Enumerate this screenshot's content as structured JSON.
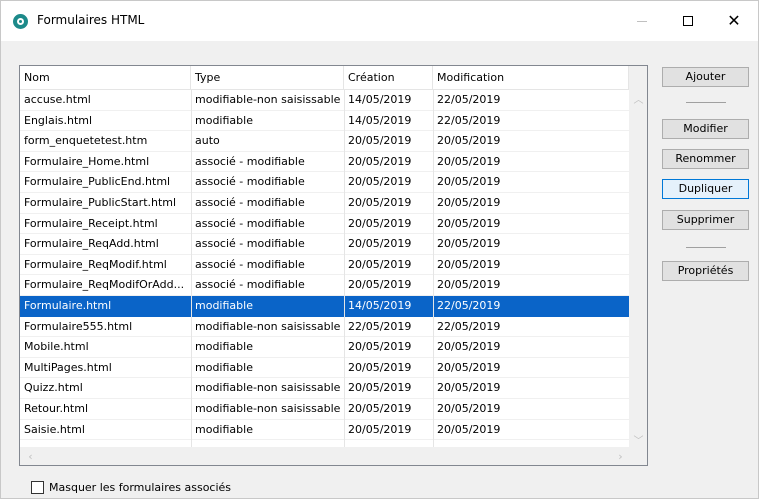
{
  "window": {
    "title": "Formulaires HTML",
    "icon": "app-logo-icon"
  },
  "list": {
    "columns": [
      "Nom",
      "Type",
      "Création",
      "Modification"
    ],
    "rows": [
      {
        "name": "accuse.html",
        "type": "modifiable-non saisissable",
        "created": "14/05/2019",
        "modified": "22/05/2019"
      },
      {
        "name": "Englais.html",
        "type": "modifiable",
        "created": "14/05/2019",
        "modified": "22/05/2019"
      },
      {
        "name": "form_enquetetest.htm",
        "type": "auto",
        "created": "20/05/2019",
        "modified": "20/05/2019"
      },
      {
        "name": "Formulaire_Home.html",
        "type": "associé - modifiable",
        "created": "20/05/2019",
        "modified": "20/05/2019"
      },
      {
        "name": "Formulaire_PublicEnd.html",
        "type": "associé - modifiable",
        "created": "20/05/2019",
        "modified": "20/05/2019"
      },
      {
        "name": "Formulaire_PublicStart.html",
        "type": "associé - modifiable",
        "created": "20/05/2019",
        "modified": "20/05/2019"
      },
      {
        "name": "Formulaire_Receipt.html",
        "type": "associé - modifiable",
        "created": "20/05/2019",
        "modified": "20/05/2019"
      },
      {
        "name": "Formulaire_ReqAdd.html",
        "type": "associé - modifiable",
        "created": "20/05/2019",
        "modified": "20/05/2019"
      },
      {
        "name": "Formulaire_ReqModif.html",
        "type": "associé - modifiable",
        "created": "20/05/2019",
        "modified": "20/05/2019"
      },
      {
        "name": "Formulaire_ReqModifOrAdd...",
        "type": "associé - modifiable",
        "created": "20/05/2019",
        "modified": "20/05/2019"
      },
      {
        "name": "Formulaire.html",
        "type": "modifiable",
        "created": "14/05/2019",
        "modified": "22/05/2019",
        "selected": true
      },
      {
        "name": "Formulaire555.html",
        "type": "modifiable-non saisissable",
        "created": "22/05/2019",
        "modified": "22/05/2019"
      },
      {
        "name": "Mobile.html",
        "type": "modifiable",
        "created": "20/05/2019",
        "modified": "20/05/2019"
      },
      {
        "name": "MultiPages.html",
        "type": "modifiable",
        "created": "20/05/2019",
        "modified": "20/05/2019"
      },
      {
        "name": "Quizz.html",
        "type": "modifiable-non saisissable",
        "created": "20/05/2019",
        "modified": "20/05/2019"
      },
      {
        "name": "Retour.html",
        "type": "modifiable-non saisissable",
        "created": "20/05/2019",
        "modified": "20/05/2019"
      },
      {
        "name": "Saisie.html",
        "type": "modifiable",
        "created": "20/05/2019",
        "modified": "20/05/2019"
      }
    ]
  },
  "buttons": {
    "add": "Ajouter",
    "edit": "Modifier",
    "rename": "Renommer",
    "duplicate": "Dupliquer",
    "delete": "Supprimer",
    "properties": "Propriétés"
  },
  "options": {
    "hide_associated_label": "Masquer les formulaires associés",
    "hide_associated_checked": false
  },
  "colors": {
    "selection": "#0a64c8",
    "accent": "#1d8a8a"
  }
}
